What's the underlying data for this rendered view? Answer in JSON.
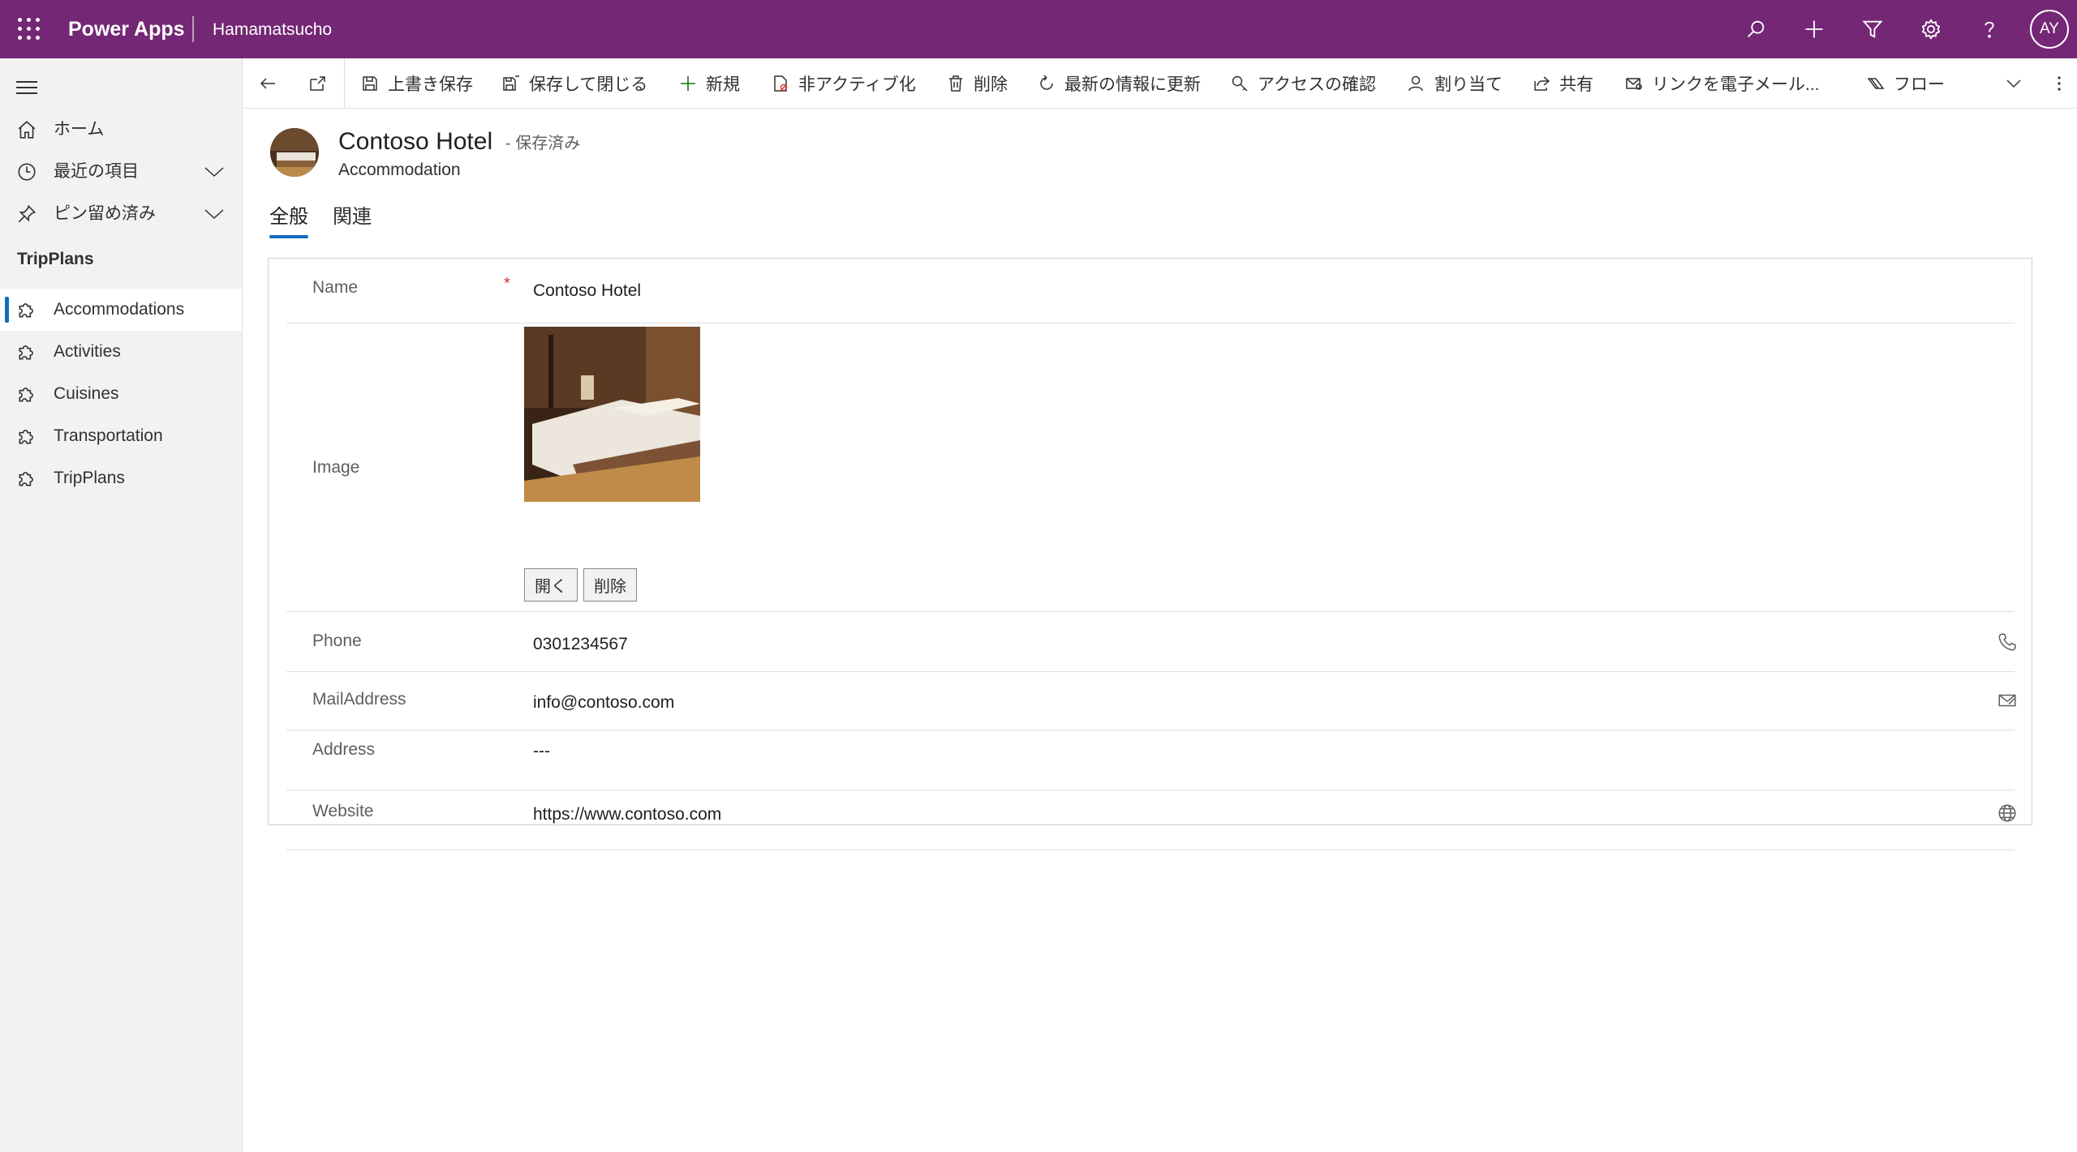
{
  "header": {
    "app_name": "Power Apps",
    "environment": "Hamamatsucho",
    "avatar_initials": "AY",
    "color": "#742774",
    "icons": [
      "search-icon",
      "add-icon",
      "filter-icon",
      "settings-icon",
      "help-icon"
    ]
  },
  "sidebar": {
    "nav": [
      {
        "label": "ホーム",
        "icon": "home-icon"
      },
      {
        "label": "最近の項目",
        "icon": "clock-icon",
        "expandable": true
      },
      {
        "label": "ピン留め済み",
        "icon": "pin-icon",
        "expandable": true
      }
    ],
    "section_title": "TripPlans",
    "items": [
      {
        "label": "Accommodations",
        "icon": "puzzle-icon",
        "active": true
      },
      {
        "label": "Activities",
        "icon": "puzzle-icon"
      },
      {
        "label": "Cuisines",
        "icon": "puzzle-icon"
      },
      {
        "label": "Transportation",
        "icon": "puzzle-icon"
      },
      {
        "label": "TripPlans",
        "icon": "puzzle-icon"
      }
    ]
  },
  "commands": {
    "save": "上書き保存",
    "save_close": "保存して閉じる",
    "new": "新規",
    "deactivate": "非アクティブ化",
    "delete": "削除",
    "refresh": "最新の情報に更新",
    "check_access": "アクセスの確認",
    "assign": "割り当て",
    "share": "共有",
    "email_link": "リンクを電子メール...",
    "flow": "フロー"
  },
  "record": {
    "title": "Contoso Hotel",
    "status": "- 保存済み",
    "entity": "Accommodation"
  },
  "tabs": [
    {
      "label": "全般",
      "active": true
    },
    {
      "label": "関連",
      "active": false
    }
  ],
  "form": {
    "name": {
      "label": "Name",
      "value": "Contoso Hotel",
      "required": true
    },
    "image": {
      "label": "Image",
      "open_button": "開く",
      "delete_button": "削除"
    },
    "phone": {
      "label": "Phone",
      "value": "0301234567"
    },
    "mail": {
      "label": "MailAddress",
      "value": "info@contoso.com"
    },
    "address": {
      "label": "Address",
      "value": "---"
    },
    "website": {
      "label": "Website",
      "value": "https://www.contoso.com"
    }
  }
}
